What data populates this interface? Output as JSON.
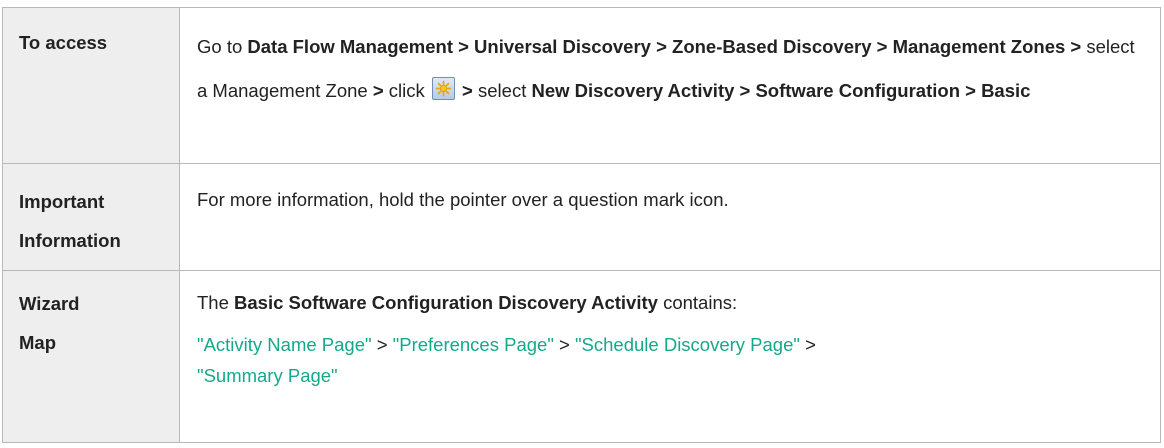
{
  "rows": [
    {
      "label": "To access",
      "access": {
        "goto": "Go to ",
        "path1": "Data Flow Management > Universal Discovery > Zone-Based Discovery > Management Zones >",
        "select_zone": " select a Management Zone ",
        "gt1": ">",
        "click": " click ",
        "icon": "new-icon",
        "gt2": " >",
        "select": " select ",
        "path2": "New Discovery Activity > Software Configuration > Basic"
      }
    },
    {
      "label_line1": "Important",
      "label_line2": "Information",
      "text": "For more information, hold the pointer over a question mark icon."
    },
    {
      "label_line1": "Wizard",
      "label_line2": "Map",
      "intro_pre": "The ",
      "intro_bold": "Basic Software Configuration Discovery Activity",
      "intro_post": " contains:",
      "links": [
        "\"Activity Name Page\"",
        "\"Preferences Page\"",
        "\"Schedule Discovery Page\"",
        "\"Summary Page\""
      ],
      "separator": " > "
    }
  ],
  "colors": {
    "link": "#16a88a",
    "label_bg": "#eeeeee",
    "border": "#b8b8b8"
  }
}
